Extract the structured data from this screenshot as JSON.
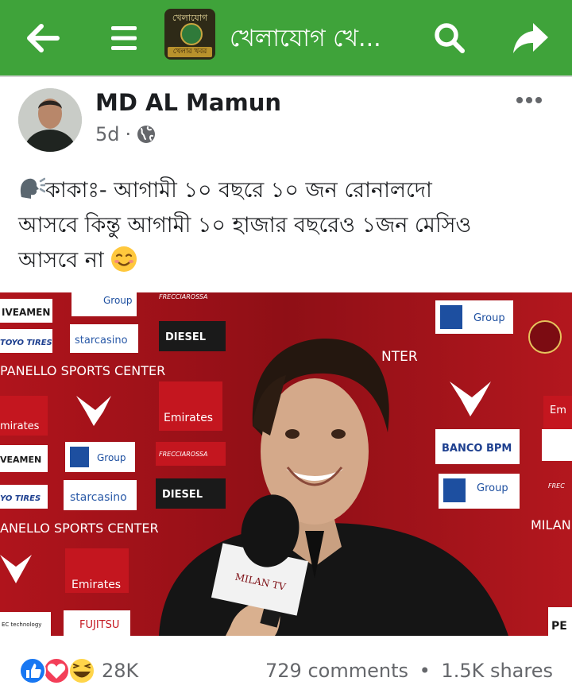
{
  "header": {
    "group_name": "খেলাযোগ খে...",
    "group_avatar_top": "খেলাযোগ",
    "group_avatar_bottom": "খেলার খবর"
  },
  "post": {
    "author": "MD AL Mamun",
    "time": "5d",
    "dot": "·",
    "text_lines": [
      "কাকাঃ- আগামী ১০ বছরে ১০ জন রোনালদো",
      "আসবে কিন্তু আগামী ১০ হাজার বছরেও ১জন মেসিও",
      "আসবে না"
    ],
    "photo": {
      "sponsors": [
        "IVEAMEN",
        "Group",
        "FRECCIAROSSA",
        "DIESEL",
        "TOYO TIRES",
        "starcasino",
        "PANELLO SPORTS CENTER",
        "Emirates",
        "BANCO BPM",
        "FUJITSU",
        "MILAN",
        "NTER",
        "PE",
        "EC technology"
      ],
      "mic_label": "MILAN TV"
    }
  },
  "footer": {
    "reaction_count": "28K",
    "comments": "729 comments",
    "bullet": "•",
    "shares": "1.5K shares"
  },
  "colors": {
    "header_bg": "#3fa33a",
    "like_blue": "#1877f2",
    "love_red": "#f33e58",
    "meta_gray": "#65676b",
    "text": "#1c1e21"
  },
  "icons": [
    "back-arrow-icon",
    "menu-icon",
    "search-icon",
    "share-arrow-icon",
    "globe-icon",
    "more-dots-icon",
    "speaking-head-icon",
    "smiling-face-icon",
    "like-icon",
    "love-icon",
    "haha-icon"
  ]
}
